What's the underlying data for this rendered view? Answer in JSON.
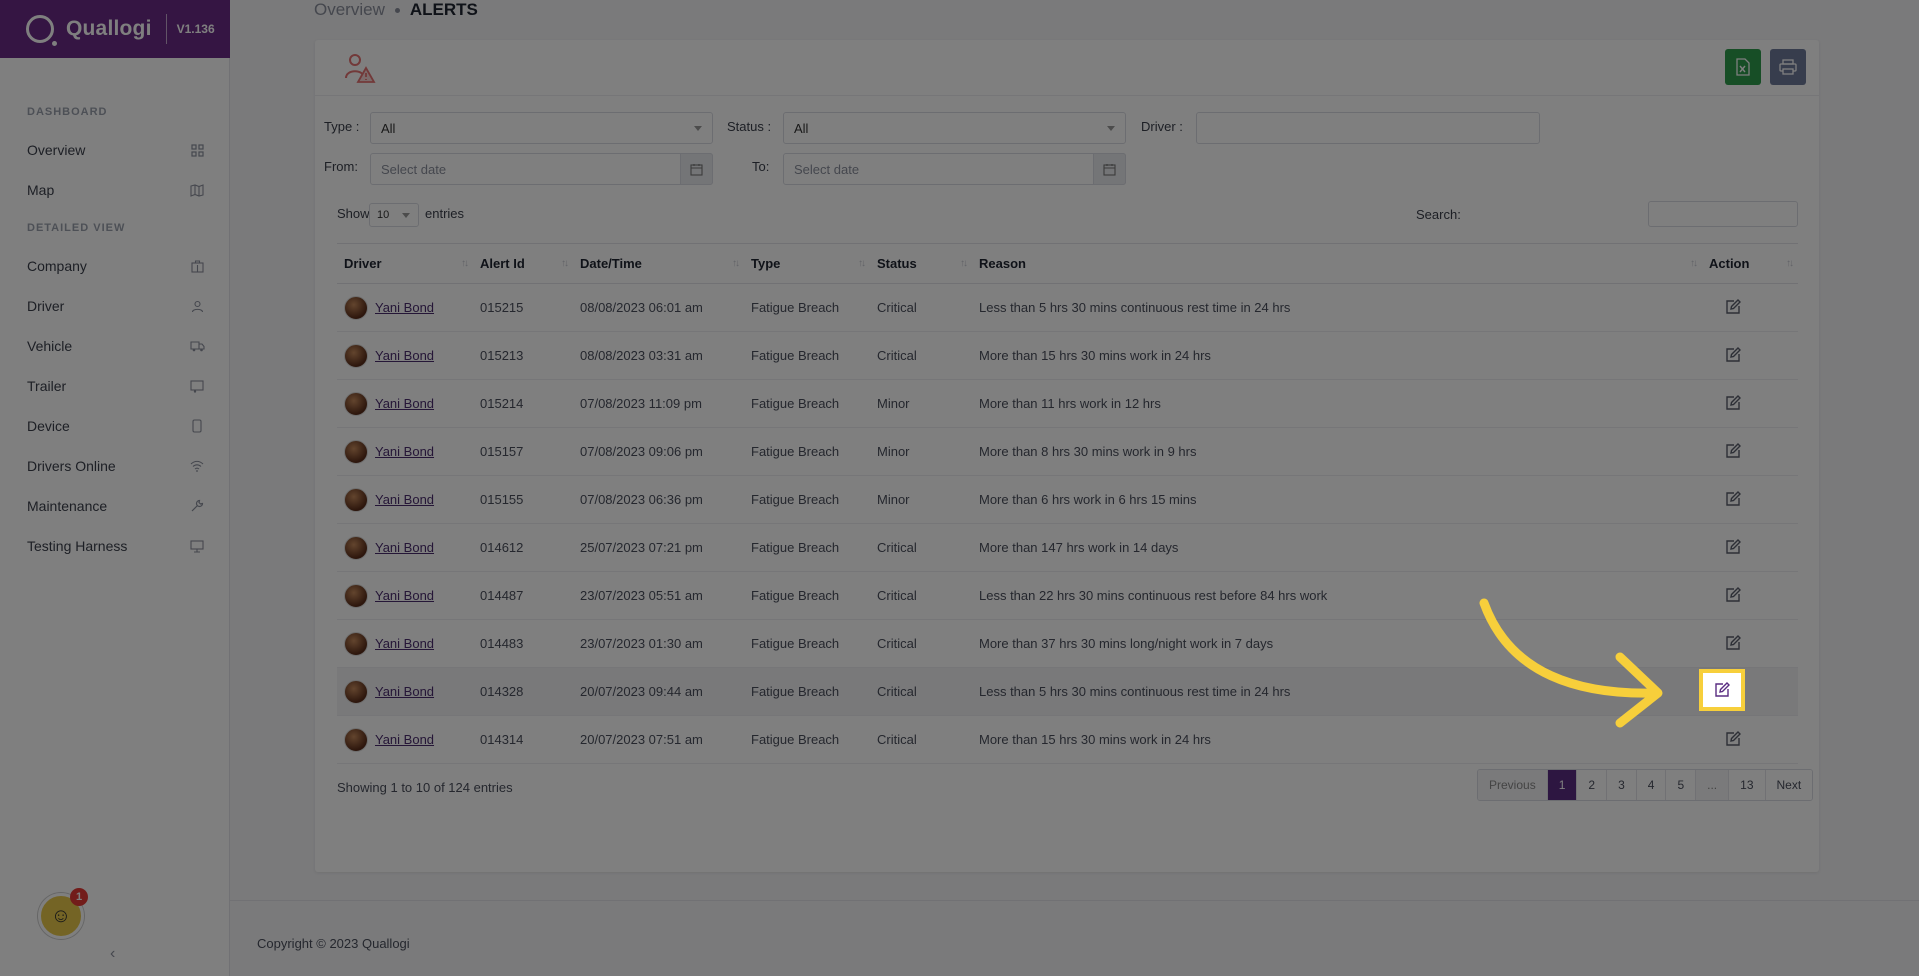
{
  "brand": {
    "name": "Quallogi",
    "version": "V1.136"
  },
  "sidebar": {
    "section_dashboard": "DASHBOARD",
    "section_detailed": "DETAILED VIEW",
    "items": [
      {
        "label": "Overview",
        "icon": "grid-icon"
      },
      {
        "label": "Map",
        "icon": "map-icon"
      },
      {
        "label": "Company",
        "icon": "building-icon"
      },
      {
        "label": "Driver",
        "icon": "user-icon"
      },
      {
        "label": "Vehicle",
        "icon": "truck-icon"
      },
      {
        "label": "Trailer",
        "icon": "trailer-icon"
      },
      {
        "label": "Device",
        "icon": "phone-icon"
      },
      {
        "label": "Drivers Online",
        "icon": "wifi-icon"
      },
      {
        "label": "Maintenance",
        "icon": "wrench-icon"
      },
      {
        "label": "Testing Harness",
        "icon": "monitor-icon"
      }
    ],
    "notification_count": "1"
  },
  "breadcrumb": {
    "parent": "Overview",
    "current": "ALERTS"
  },
  "filters": {
    "type_label": "Type :",
    "type_value": "All",
    "status_label": "Status :",
    "status_value": "All",
    "driver_label": "Driver :",
    "from_label": "From:",
    "from_placeholder": "Select date",
    "to_label": "To:",
    "to_placeholder": "Select date"
  },
  "table_controls": {
    "show_label": "Show",
    "entries_value": "10",
    "entries_label": "entries",
    "search_label": "Search:"
  },
  "columns": [
    "Driver",
    "Alert Id",
    "Date/Time",
    "Type",
    "Status",
    "Reason",
    "Action"
  ],
  "rows": [
    {
      "driver": "Yani Bond",
      "id": "015215",
      "datetime": "08/08/2023 06:01 am",
      "type": "Fatigue Breach",
      "status": "Critical",
      "reason": "Less than 5 hrs 30 mins continuous rest time in 24 hrs"
    },
    {
      "driver": "Yani Bond",
      "id": "015213",
      "datetime": "08/08/2023 03:31 am",
      "type": "Fatigue Breach",
      "status": "Critical",
      "reason": "More than 15 hrs 30 mins work in 24 hrs"
    },
    {
      "driver": "Yani Bond",
      "id": "015214",
      "datetime": "07/08/2023 11:09 pm",
      "type": "Fatigue Breach",
      "status": "Minor",
      "reason": "More than 11 hrs work in 12 hrs"
    },
    {
      "driver": "Yani Bond",
      "id": "015157",
      "datetime": "07/08/2023 09:06 pm",
      "type": "Fatigue Breach",
      "status": "Minor",
      "reason": "More than 8 hrs 30 mins work in 9 hrs"
    },
    {
      "driver": "Yani Bond",
      "id": "015155",
      "datetime": "07/08/2023 06:36 pm",
      "type": "Fatigue Breach",
      "status": "Minor",
      "reason": "More than 6 hrs work in 6 hrs 15 mins"
    },
    {
      "driver": "Yani Bond",
      "id": "014612",
      "datetime": "25/07/2023 07:21 pm",
      "type": "Fatigue Breach",
      "status": "Critical",
      "reason": "More than 147 hrs work in 14 days"
    },
    {
      "driver": "Yani Bond",
      "id": "014487",
      "datetime": "23/07/2023 05:51 am",
      "type": "Fatigue Breach",
      "status": "Critical",
      "reason": "Less than 22 hrs 30 mins continuous rest before 84 hrs work"
    },
    {
      "driver": "Yani Bond",
      "id": "014483",
      "datetime": "23/07/2023 01:30 am",
      "type": "Fatigue Breach",
      "status": "Critical",
      "reason": "More than 37 hrs 30 mins long/night work in 7 days"
    },
    {
      "driver": "Yani Bond",
      "id": "014328",
      "datetime": "20/07/2023 09:44 am",
      "type": "Fatigue Breach",
      "status": "Critical",
      "reason": "Less than 5 hrs 30 mins continuous rest time in 24 hrs"
    },
    {
      "driver": "Yani Bond",
      "id": "014314",
      "datetime": "20/07/2023 07:51 am",
      "type": "Fatigue Breach",
      "status": "Critical",
      "reason": "More than 15 hrs 30 mins work in 24 hrs"
    }
  ],
  "info": "Showing 1 to 10 of 124 entries",
  "pagination": [
    "Previous",
    "1",
    "2",
    "3",
    "4",
    "5",
    "...",
    "13",
    "Next"
  ],
  "footer": "Copyright © 2023 Quallogi",
  "colors": {
    "brand": "#6b2a86",
    "excel": "#2e9d4c",
    "print": "#6e7a9a",
    "highlight": "#f7cf3b"
  }
}
